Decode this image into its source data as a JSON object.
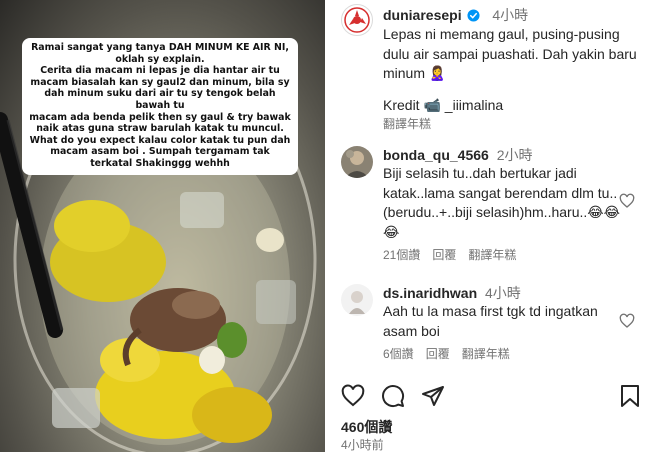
{
  "media": {
    "overlay_text": [
      "Ramai sangat yang tanya DAH MINUM KE AIR NI,",
      "oklah sy explain.",
      "Cerita dia macam ni lepas je dia hantar air tu",
      "macam biasalah kan sy gaul2 dan minum, bila sy",
      "dah minum suku dari air tu sy tengok belah bawah tu",
      "macam ada benda pelik then sy gaul & try bawak",
      "naik atas guna straw barulah katak tu muncul.",
      "What do you expect kalau color katak tu pun dah",
      "macam asam boi . Sumpah tergamam tak",
      "terkatal Shakinggg wehhh"
    ]
  },
  "post": {
    "username": "duniaresepi",
    "time": "4小時",
    "caption": "Lepas ni memang gaul, pusing-pusing dulu air sampai puashati. Dah yakin baru minum 🙎‍♀️",
    "credit_label": "Kredit",
    "credit_emoji": "📹",
    "credit_user": "_iiimalina",
    "translate": "翻譯年糕"
  },
  "comments": [
    {
      "username": "bonda_qu_4566",
      "time": "2小時",
      "text": "Biji selasih tu..dah bertukar jadi katak..lama sangat berendam dlm tu..(berudu..+..biji selasih)hm..haru..😂😂😂",
      "likes": "21個讚",
      "reply": "回覆",
      "translate": "翻譯年糕"
    },
    {
      "username": "ds.inaridhwan",
      "time": "4小時",
      "text": "Aah tu la masa first tgk td ingatkan asam boi",
      "likes": "6個讚",
      "reply": "回覆",
      "translate": "翻譯年糕"
    }
  ],
  "footer": {
    "likes": "460個讚",
    "posted": "4小時前"
  },
  "icons": {
    "like": "heart-outline-icon",
    "comment": "comment-bubble-icon",
    "share": "paper-plane-icon",
    "save": "bookmark-icon"
  },
  "colors": {
    "text": "#262626",
    "muted": "#737373",
    "verified": "#0095f6",
    "brand_red": "#d62f2f"
  }
}
